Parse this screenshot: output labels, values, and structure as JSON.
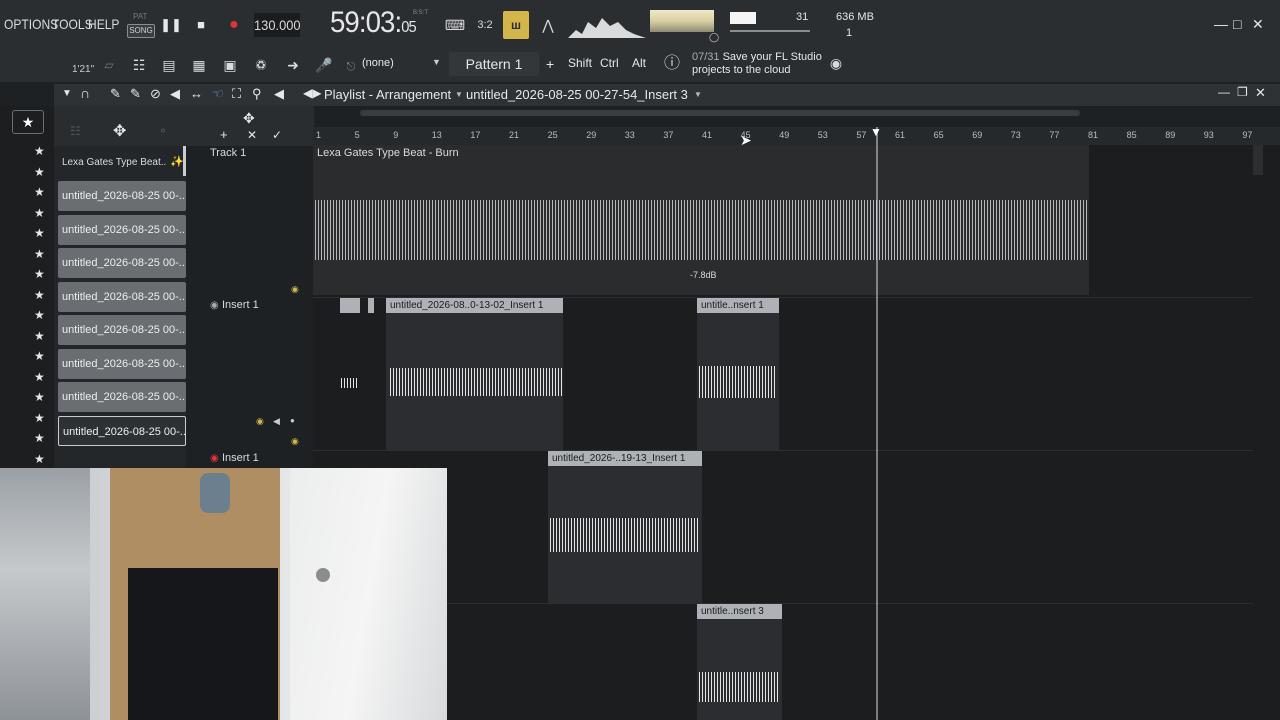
{
  "menu": [
    "OPTIONS",
    "TOOLS",
    "HELP"
  ],
  "transport": {
    "pat_label": "PAT",
    "song_label": "SONG",
    "tempo": "130.000",
    "time_main": "59:03",
    "time_sub": "05",
    "time_unit": "B:S:T"
  },
  "system": {
    "cpu": "31",
    "memory": "636 MB",
    "polyphony": "1"
  },
  "bar2": {
    "version": "1'21\"",
    "snap": "(none)",
    "pattern": "Pattern 1",
    "plus": "+",
    "keys": [
      "Shift",
      "Ctrl",
      "Alt"
    ],
    "hint_count": "07/31",
    "hint_text": "Save your FL Studio projects to the cloud"
  },
  "playlist": {
    "title": "Playlist - Arrangement",
    "file": "untitled_2026-08-25 00-27-54_Insert 3",
    "ruler": [
      "1",
      "5",
      "9",
      "13",
      "17",
      "21",
      "25",
      "29",
      "33",
      "37",
      "41",
      "45",
      "49",
      "53",
      "57",
      "61",
      "65",
      "69",
      "73",
      "77",
      "81",
      "85",
      "89",
      "93",
      "97"
    ]
  },
  "picker": {
    "header": "Lexa Gates Type Beat..",
    "clips": [
      "untitled_2026-08-25 00-..",
      "untitled_2026-08-25 00-..",
      "untitled_2026-08-25 00-..",
      "untitled_2026-08-25 00-..",
      "untitled_2026-08-25 00-..",
      "untitled_2026-08-25 00-..",
      "untitled_2026-08-25 00-..",
      "untitled_2026-08-25 00-.."
    ]
  },
  "tracks": [
    {
      "name": "Track 1"
    },
    {
      "name": "Insert 1"
    },
    {
      "name": "Insert 1"
    }
  ],
  "regions": {
    "beat": "Lexa Gates Type Beat - Burn",
    "gain": "-7.8dB",
    "r1": "untitled_2026-08..0-13-02_Insert 1",
    "r2": "untitle..nsert 1",
    "r3": "untitled_2026-..19-13_Insert 1",
    "r4": "untitle..nsert 3"
  },
  "colors": {
    "accent": "#d2b54b",
    "record": "#e0333b",
    "region_label": "#aeb2b6"
  }
}
